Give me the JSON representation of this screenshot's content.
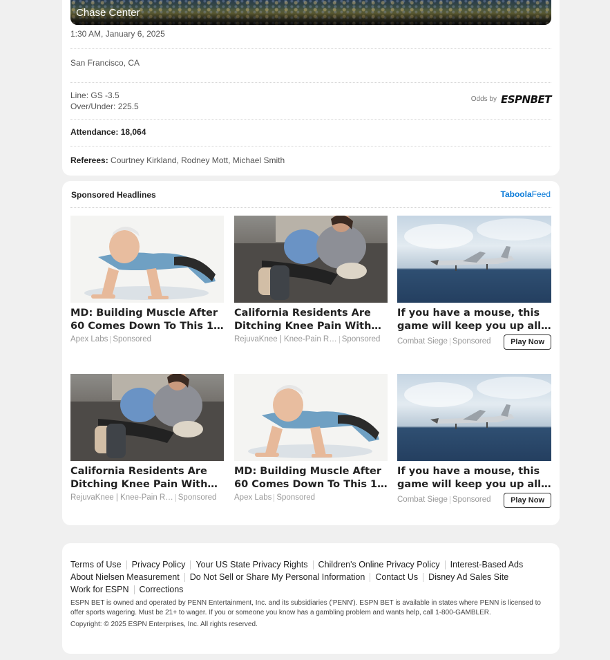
{
  "game": {
    "venue": "Chase Center",
    "datetime": "1:30 AM, January 6, 2025",
    "location": "San Francisco, CA",
    "line": "Line: GS -3.5",
    "over_under": "Over/Under: 225.5",
    "odds_by": "Odds by",
    "odds_brand": "ESPNBET",
    "attendance_label": "Attendance:",
    "attendance_value": "18,064",
    "referees_label": "Referees:",
    "referees_value": "Courtney Kirkland, Rodney Mott, Michael Smith"
  },
  "sponsored": {
    "title": "Sponsored Headlines",
    "provider": "Taboola",
    "provider_suffix": "Feed",
    "ads": [
      {
        "image": "pushup-man-illustration",
        "headline": "MD: Building Muscle After 60 Comes Down To This 1…",
        "brand": "Apex Labs",
        "sponsored": "Sponsored"
      },
      {
        "image": "woman-knee-brace-photo",
        "headline": "California Residents Are Ditching Knee Pain With…",
        "brand": "RejuvaKnee | Knee-Pain R…",
        "sponsored": "Sponsored"
      },
      {
        "image": "fighter-jet-over-ocean",
        "headline": "If you have a mouse, this game will keep you up all…",
        "brand": "Combat Siege",
        "sponsored": "Sponsored",
        "cta": "Play Now"
      },
      {
        "image": "woman-knee-brace-photo",
        "headline": "California Residents Are Ditching Knee Pain With…",
        "brand": "RejuvaKnee | Knee-Pain R…",
        "sponsored": "Sponsored"
      },
      {
        "image": "pushup-man-illustration",
        "headline": "MD: Building Muscle After 60 Comes Down To This 1…",
        "brand": "Apex Labs",
        "sponsored": "Sponsored"
      },
      {
        "image": "fighter-jet-over-ocean",
        "headline": "If you have a mouse, this game will keep you up all…",
        "brand": "Combat Siege",
        "sponsored": "Sponsored",
        "cta": "Play Now"
      }
    ]
  },
  "footer": {
    "links": [
      "Terms of Use",
      "Privacy Policy",
      "Your US State Privacy Rights",
      "Children's Online Privacy Policy",
      "Interest-Based Ads",
      "About Nielsen Measurement",
      "Do Not Sell or Share My Personal Information",
      "Contact Us",
      "Disney Ad Sales Site",
      "Work for ESPN",
      "Corrections"
    ],
    "disclaimer": "ESPN BET is owned and operated by PENN Entertainment, Inc. and its subsidiaries ('PENN'). ESPN BET is available in states where PENN is licensed to offer sports wagering. Must be 21+ to wager. If you or someone you know has a gambling problem and wants help, call 1-800-GAMBLER.",
    "copyright": "Copyright: © 2025 ESPN Enterprises, Inc. All rights reserved."
  }
}
